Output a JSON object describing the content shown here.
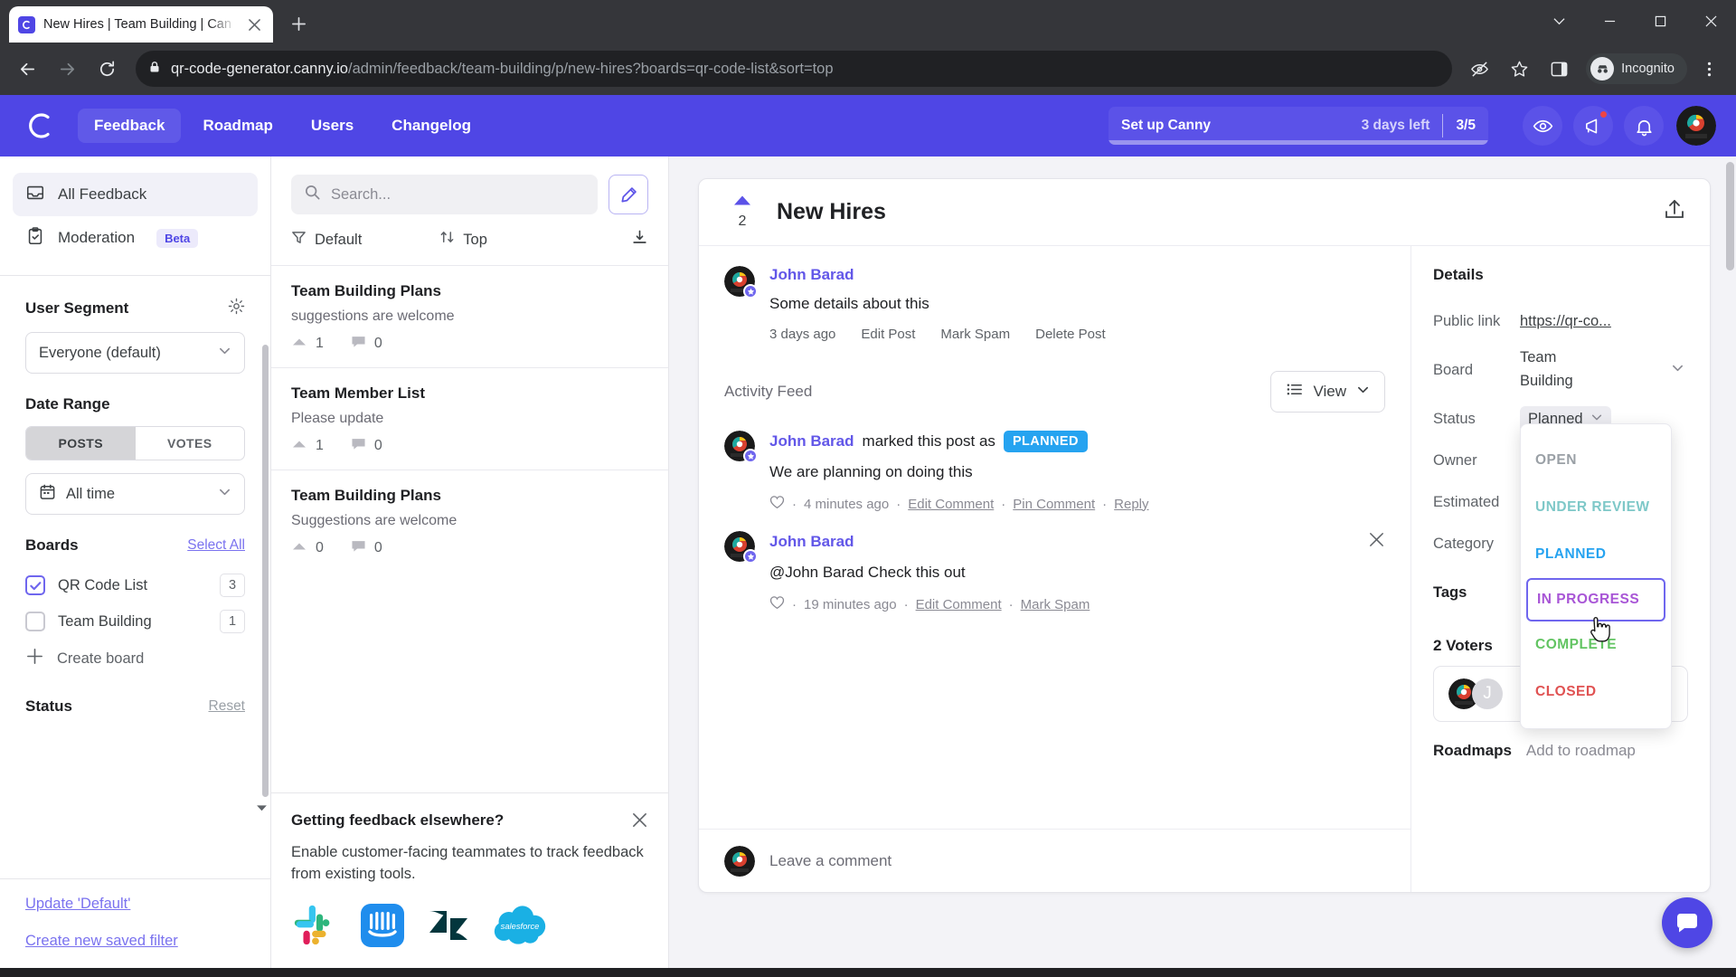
{
  "browser": {
    "tab_title": "New Hires | Team Building | Can",
    "url_domain": "qr-code-generator.canny.io",
    "url_path": "/admin/feedback/team-building/p/new-hires?boards=qr-code-list&sort=top",
    "profile_label": "Incognito",
    "back_icon": "back-arrow-icon",
    "forward_icon": "forward-arrow-icon",
    "reload_icon": "reload-icon",
    "lock_icon": "lock-icon"
  },
  "topnav": {
    "logo": "canny-logo",
    "links": [
      {
        "label": "Feedback",
        "active": true
      },
      {
        "label": "Roadmap",
        "active": false
      },
      {
        "label": "Users",
        "active": false
      },
      {
        "label": "Changelog",
        "active": false
      }
    ],
    "setup": {
      "title": "Set up Canny",
      "days_left": "3 days left",
      "count": "3/5",
      "progress_percent": 60
    },
    "icons": [
      "eye-icon",
      "megaphone-icon",
      "bell-icon"
    ],
    "avatar": "user-avatar"
  },
  "sidebar": {
    "nav": [
      {
        "label": "All Feedback",
        "icon": "inbox-icon",
        "active": true,
        "badge": ""
      },
      {
        "label": "Moderation",
        "icon": "clipboard-check-icon",
        "active": false,
        "badge": "Beta"
      }
    ],
    "user_segment": {
      "title": "User Segment",
      "gear_icon": "gear-icon",
      "value": "Everyone (default)"
    },
    "date_range": {
      "title": "Date Range",
      "tabs": [
        {
          "label": "POSTS",
          "active": true
        },
        {
          "label": "VOTES",
          "active": false
        }
      ],
      "value": "All time",
      "icon": "calendar-icon"
    },
    "boards": {
      "title": "Boards",
      "select_all": "Select All",
      "items": [
        {
          "label": "QR Code List",
          "count": "3",
          "checked": true
        },
        {
          "label": "Team Building",
          "count": "1",
          "checked": false
        }
      ],
      "create": "Create board"
    },
    "status": {
      "title": "Status",
      "reset": "Reset"
    },
    "footer_links": [
      "Update 'Default'",
      "Create new saved filter"
    ]
  },
  "postlist": {
    "search_placeholder": "Search...",
    "search_value": "",
    "search_icon": "search-icon",
    "compose_icon": "pencil-icon",
    "filter_label": "Default",
    "filter_icon": "funnel-icon",
    "sort_label": "Top",
    "sort_icon": "sort-icon",
    "export_icon": "download-icon",
    "rows": [
      {
        "title": "Team Building Plans",
        "subtitle": "suggestions are welcome",
        "votes": "1",
        "comments": "0"
      },
      {
        "title": "Team Member List",
        "subtitle": "Please update",
        "votes": "1",
        "comments": "0"
      },
      {
        "title": "Team Building Plans",
        "subtitle": "Suggestions are welcome",
        "votes": "0",
        "comments": "0"
      }
    ],
    "promo": {
      "title": "Getting feedback elsewhere?",
      "body": "Enable customer-facing teammates to track feedback from existing tools.",
      "close_icon": "close-icon",
      "logos": [
        "slack-logo",
        "intercom-logo",
        "zendesk-logo",
        "salesforce-logo"
      ]
    }
  },
  "post": {
    "title": "New Hires",
    "vote_count": "2",
    "vote_icon": "upvote-caret-icon",
    "share_icon": "share-icon",
    "author": "John Barad",
    "body": "Some details about this",
    "meta_time": "3 days ago",
    "meta_actions": [
      "Edit Post",
      "Mark Spam",
      "Delete Post"
    ],
    "activity_feed_label": "Activity Feed",
    "view_button": "View",
    "view_icon": "list-icon",
    "comments": [
      {
        "author": "John Barad",
        "action_text": "marked this post as",
        "status_badge": "PLANNED",
        "body": "We are planning on doing this",
        "time": "4 minutes ago",
        "actions": [
          "Edit Comment",
          "Pin Comment",
          "Reply"
        ],
        "like_icon": "heart-icon",
        "has_close": false
      },
      {
        "author": "John Barad",
        "action_text": "",
        "status_badge": "",
        "body": "@John Barad Check this out",
        "time": "19 minutes ago",
        "actions": [
          "Edit Comment",
          "Mark Spam"
        ],
        "like_icon": "heart-icon",
        "has_close": true
      }
    ],
    "comment_placeholder": "Leave a comment"
  },
  "details": {
    "title": "Details",
    "rows": [
      {
        "label": "Public link",
        "value": "https://qr-co...",
        "type": "link"
      },
      {
        "label": "Board",
        "value": "Team Building",
        "type": "select"
      },
      {
        "label": "Status",
        "value": "Planned",
        "type": "chip"
      },
      {
        "label": "Owner",
        "value": "",
        "type": "text"
      },
      {
        "label": "Estimated",
        "value": "",
        "type": "text"
      },
      {
        "label": "Category",
        "value": "",
        "type": "text"
      },
      {
        "label": "Tags",
        "value": "",
        "type": "text"
      }
    ],
    "status_menu": [
      {
        "label": "OPEN",
        "color": "#9aa0a6",
        "selected": false
      },
      {
        "label": "UNDER REVIEW",
        "color": "#7ec8c8",
        "selected": false
      },
      {
        "label": "PLANNED",
        "color": "#26a3f0",
        "selected": false
      },
      {
        "label": "IN PROGRESS",
        "color": "#a855d6",
        "selected": true
      },
      {
        "label": "COMPLETE",
        "color": "#62c462",
        "selected": false
      },
      {
        "label": "CLOSED",
        "color": "#e05252",
        "selected": false
      }
    ],
    "voters_title": "2 Voters",
    "voter_initial": "J",
    "roadmaps_label": "Roadmaps",
    "roadmaps_action": "Add to roadmap"
  },
  "widget": {
    "icon": "chat-bubble-icon",
    "color": "#4f46e5"
  }
}
